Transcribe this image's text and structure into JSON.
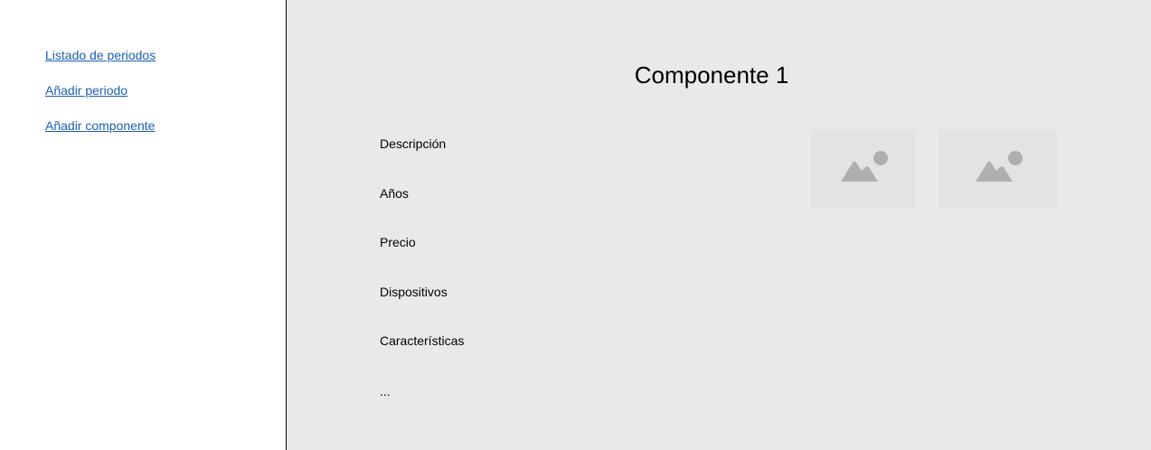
{
  "sidebar": {
    "links": [
      {
        "label": "Listado de periodos"
      },
      {
        "label": "Añadir periodo"
      },
      {
        "label": "Añadir componente"
      }
    ]
  },
  "main": {
    "title": "Componente 1",
    "fields": [
      {
        "label": "Descripción"
      },
      {
        "label": "Años"
      },
      {
        "label": "Precio"
      },
      {
        "label": "Dispositivos"
      },
      {
        "label": "Características"
      },
      {
        "label": "..."
      }
    ],
    "images": [
      {
        "icon": "image-placeholder-icon"
      },
      {
        "icon": "image-placeholder-icon"
      }
    ]
  },
  "colors": {
    "link": "#1a5fb4",
    "main_background": "#e9e9e9",
    "placeholder_background": "#e3e3e3",
    "placeholder_icon": "#afafaf"
  }
}
